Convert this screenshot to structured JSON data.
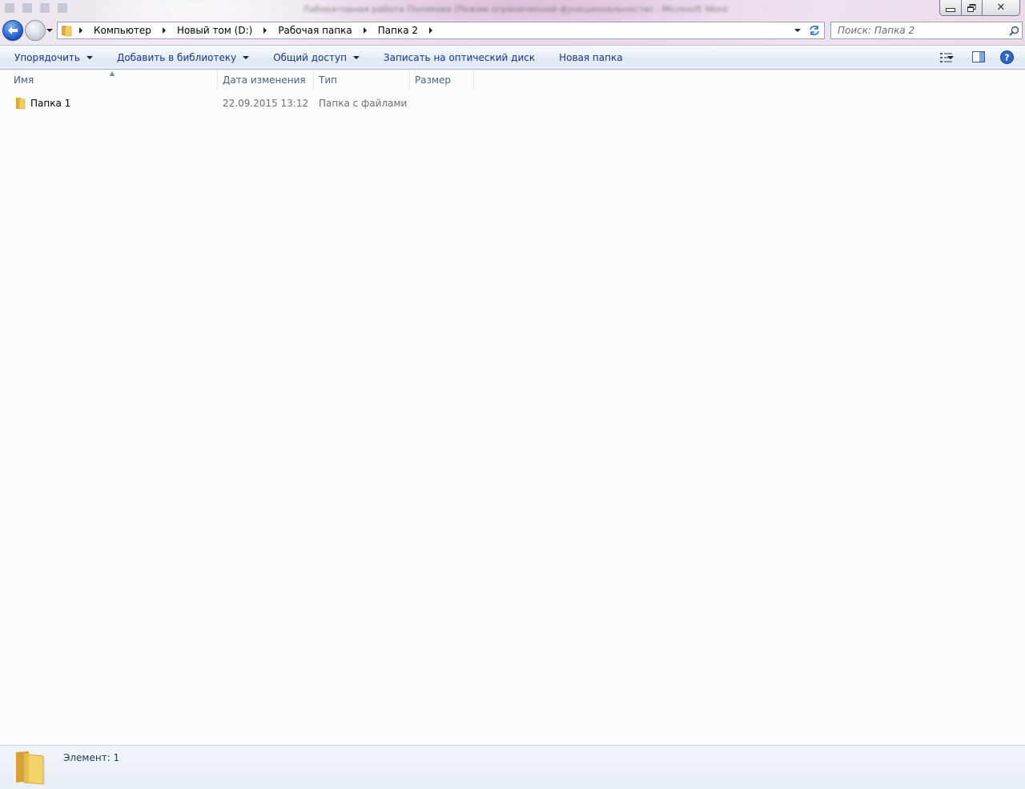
{
  "window": {
    "title": "Лабораторная работа Полякова (Режим ограниченной функциональности) - Microsoft Word",
    "minimize_label": "—",
    "maximize_label": "□",
    "close_label": "✕"
  },
  "nav": {
    "breadcrumbs": [
      {
        "label": "Компьютер"
      },
      {
        "label": "Новый том (D:)"
      },
      {
        "label": "Рабочая папка"
      },
      {
        "label": "Папка 2"
      }
    ]
  },
  "search": {
    "placeholder": "Поиск: Папка 2",
    "value": ""
  },
  "toolbar": {
    "organize": "Упорядочить",
    "add_to_library": "Добавить в библиотеку",
    "share": "Общий доступ",
    "burn": "Записать на оптический диск",
    "new_folder": "Новая папка"
  },
  "columns": {
    "name": "Имя",
    "date": "Дата изменения",
    "type": "Тип",
    "size": "Размер"
  },
  "files": [
    {
      "name": "Папка 1",
      "date": "22.09.2015 13:12",
      "type": "Папка с файлами",
      "size": ""
    }
  ],
  "details": {
    "count_text": "Элемент: 1"
  },
  "colors": {
    "toolbar_text": "#1e3287",
    "header_text": "#4c607a",
    "accent_blue": "#1b58c8",
    "folder_yellow": "#f2cf61"
  }
}
